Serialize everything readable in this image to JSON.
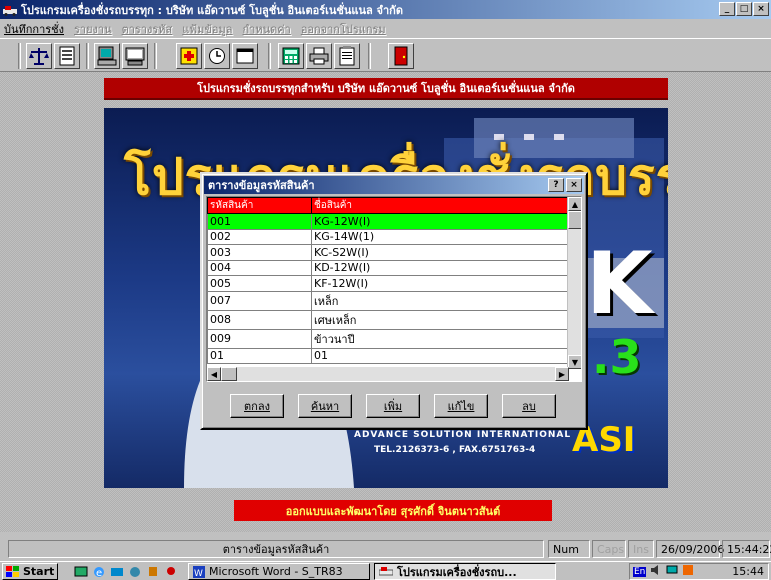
{
  "window": {
    "title": "โปรแกรมเครื่องชั่งรถบรรทุก : บริษัท แอ๊ดวานซ์ โบลูชั่น อินเตอร์เนชั่นแนล จำกัด",
    "controls": [
      "_",
      "□",
      "×"
    ]
  },
  "menu": [
    {
      "label": "บันทึกการชั่ง",
      "enabled": true
    },
    {
      "label": "รายงาน",
      "enabled": false
    },
    {
      "label": "ตารางรหัส",
      "enabled": false
    },
    {
      "label": "แฟ้มข้อมูล",
      "enabled": false
    },
    {
      "label": "กำหนดค่า",
      "enabled": false
    },
    {
      "label": "ออกจากโปรแกรม",
      "enabled": false
    }
  ],
  "toolbar": {
    "buttons": [
      "scale-icon",
      "document-icon",
      "computer-icon",
      "terminal-icon",
      "add-icon",
      "clock-icon",
      "window-icon",
      "calculator-icon",
      "printer-icon",
      "notepad-icon",
      "exit-door-icon"
    ]
  },
  "banner_top": "โปรแกรมชั่งรถบรรทุกสำหรับ บริษัท แอ๊ดวานซ์ โบลูชั่น อินเตอร์เนชั่นแนล จำกัด",
  "splash": {
    "title": "โปรแกรมเครื่องชั่งรถบรรทุก",
    "logo_letter": "K",
    "version": ".3",
    "company_line": "ADVANCE SOLUTION INTERNATIONAL",
    "company_tel": "TEL.2126373-6 , FAX.6751763-4",
    "company_logo": "ASI"
  },
  "banner_bottom": "ออกแบบและพัฒนาโดย   สุรศักดิ์ จินตนาวสันต์",
  "dialog": {
    "title": "ตารางข้อมูลรหัสสินค้า",
    "help": "?",
    "close": "×",
    "columns": [
      "รหัสสินค้า",
      "ชื่อสินค้า"
    ],
    "rows": [
      [
        "001",
        "KG-12W(I)"
      ],
      [
        "002",
        "KG-14W(1)"
      ],
      [
        "003",
        "KC-S2W(I)"
      ],
      [
        "004",
        "KD-12W(I)"
      ],
      [
        "005",
        "KF-12W(I)"
      ],
      [
        "007",
        "เหล็ก"
      ],
      [
        "008",
        "เศษเหล็ก"
      ],
      [
        "009",
        "ข้าวนาปี"
      ],
      [
        "01",
        "01"
      ]
    ],
    "selected_row": 0,
    "buttons": [
      "ตกลง",
      "ค้นหา",
      "เพิ่ม",
      "แก้ไข",
      "ลบ"
    ]
  },
  "statusbar": {
    "message": "ตารางข้อมูลรหัสสินค้า",
    "num": "Num",
    "caps": "Caps",
    "ins": "Ins",
    "date": "26/09/2006",
    "time": "15:44:22"
  },
  "taskbar": {
    "start": "Start",
    "quicklaunch": [
      "desktop-icon",
      "ie-icon",
      "outlook-icon",
      "media-icon",
      "app-icon",
      "misc-icon"
    ],
    "tasks": [
      {
        "label": "Microsoft Word - S_TR83",
        "active": false
      },
      {
        "label": "โปรแกรมเครื่องชั่งรถบ...",
        "active": true
      }
    ],
    "tray": [
      "language-indicator",
      "volume-icon",
      "network-icon",
      "app-tray-icon"
    ],
    "lang": "En",
    "clock": "15:44"
  },
  "colors": {
    "titlebar": "#0a246a",
    "banner_top": "#b00000",
    "grid_header": "#ff0000",
    "selected_row": "#00ff00",
    "banner_bottom": "#e00000"
  }
}
